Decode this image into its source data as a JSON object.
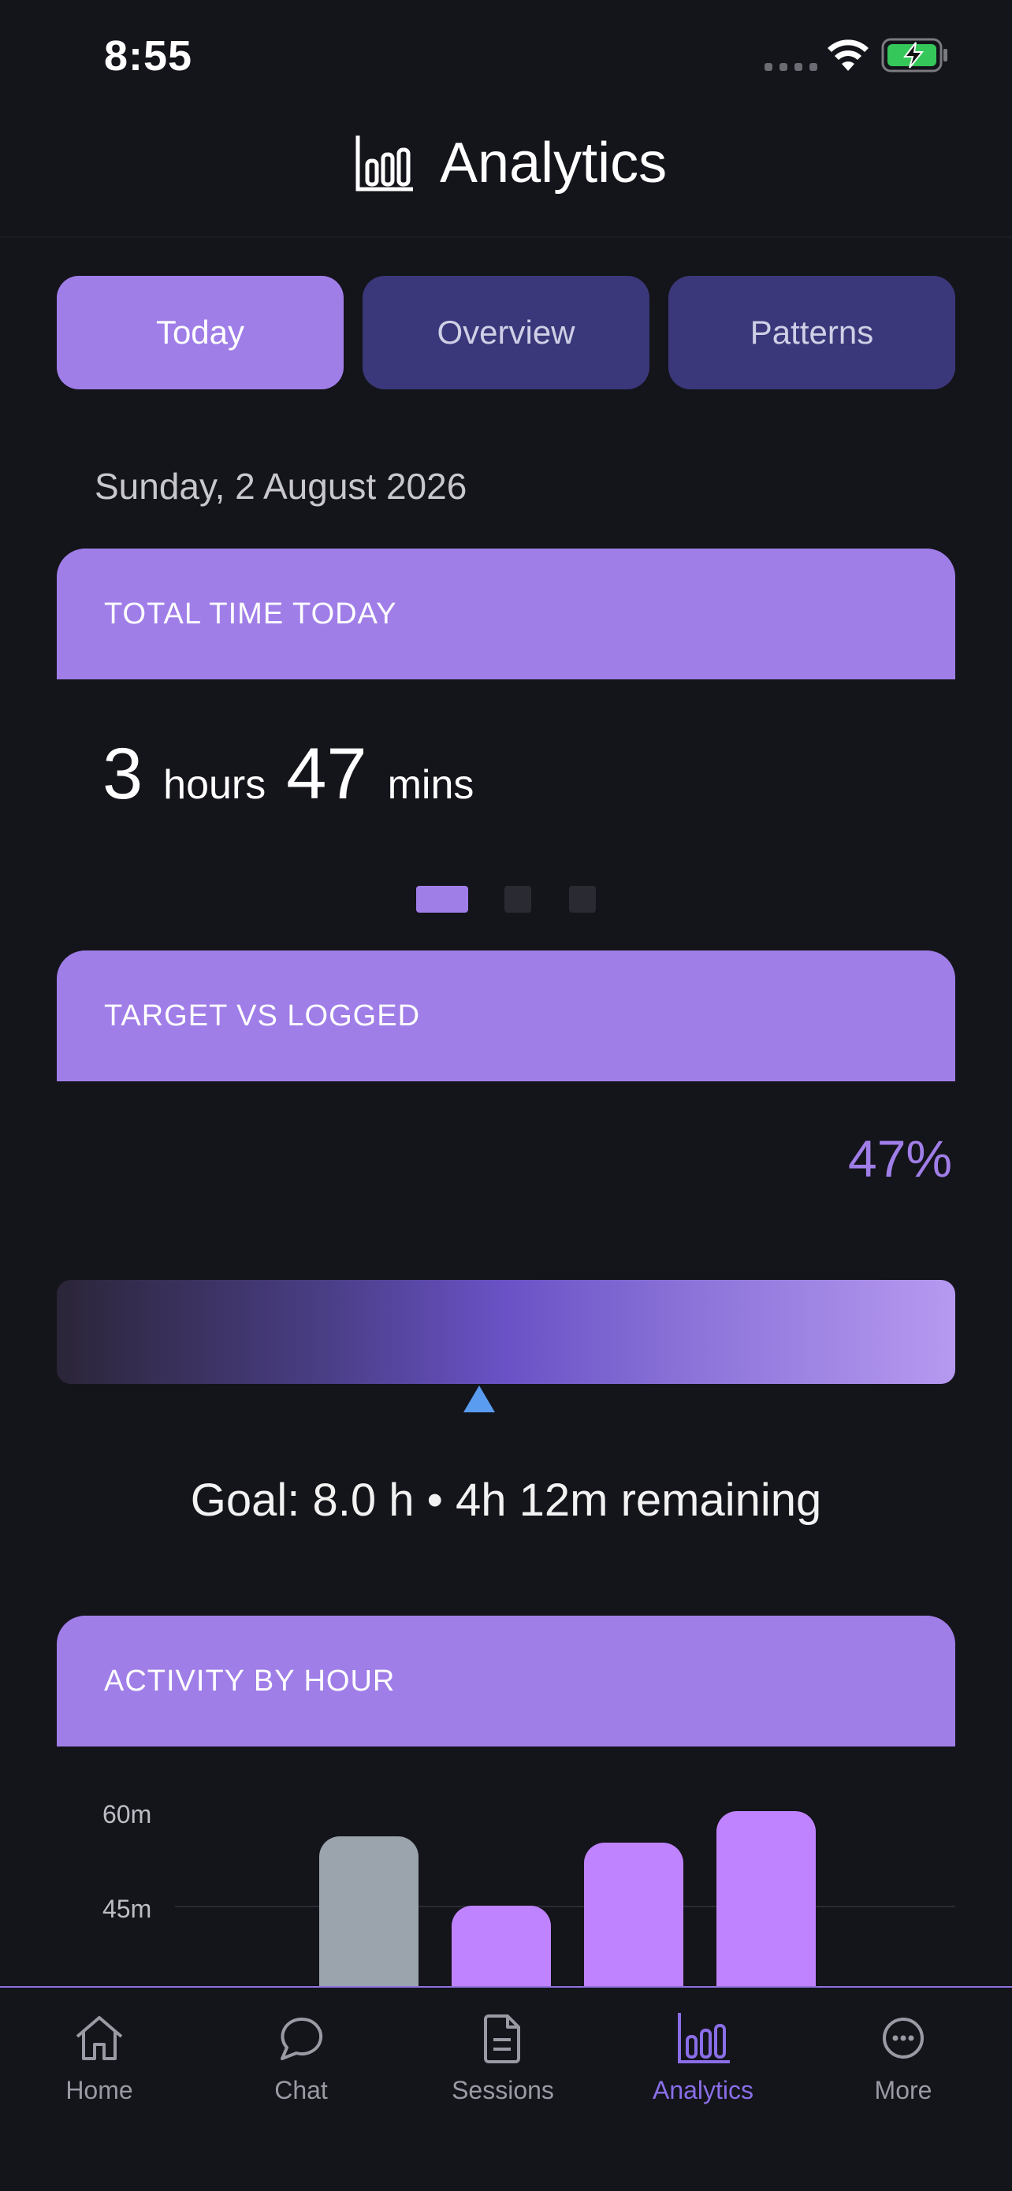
{
  "status_bar": {
    "time": "8:55"
  },
  "header": {
    "title": "Analytics",
    "icon": "bar-chart-icon"
  },
  "tabs": [
    {
      "label": "Today",
      "active": true
    },
    {
      "label": "Overview",
      "active": false
    },
    {
      "label": "Patterns",
      "active": false
    }
  ],
  "date": "Sunday, 2 August 2026",
  "total_time_card": {
    "header": "TOTAL TIME TODAY",
    "hours": "3",
    "hours_unit": "hours",
    "mins": "47",
    "mins_unit": "mins"
  },
  "pager": {
    "count": 3,
    "active_index": 0
  },
  "target_card": {
    "header": "TARGET VS LOGGED",
    "percent": "47%",
    "progress": 0.47,
    "goal_text": "Goal: 8.0 h • 4h 12m remaining"
  },
  "activity_card": {
    "header": "ACTIVITY BY HOUR"
  },
  "chart_data": {
    "type": "bar",
    "y_ticks": [
      "60m",
      "45m"
    ],
    "ylim": [
      0,
      60
    ],
    "values": [
      56,
      45,
      55,
      60
    ],
    "colors": [
      "#9ba4ad",
      "#c083ff",
      "#c083ff",
      "#c083ff"
    ]
  },
  "nav": [
    {
      "label": "Home",
      "icon": "home-icon",
      "active": false
    },
    {
      "label": "Chat",
      "icon": "chat-bubble-icon",
      "active": false
    },
    {
      "label": "Sessions",
      "icon": "document-icon",
      "active": false
    },
    {
      "label": "Analytics",
      "icon": "bar-chart-icon",
      "active": true
    },
    {
      "label": "More",
      "icon": "more-circle-icon",
      "active": false
    }
  ],
  "colors": {
    "accent": "#a07ee8",
    "tab_inactive": "#3a387a",
    "background": "#14141b",
    "marker": "#5a9cf0"
  }
}
